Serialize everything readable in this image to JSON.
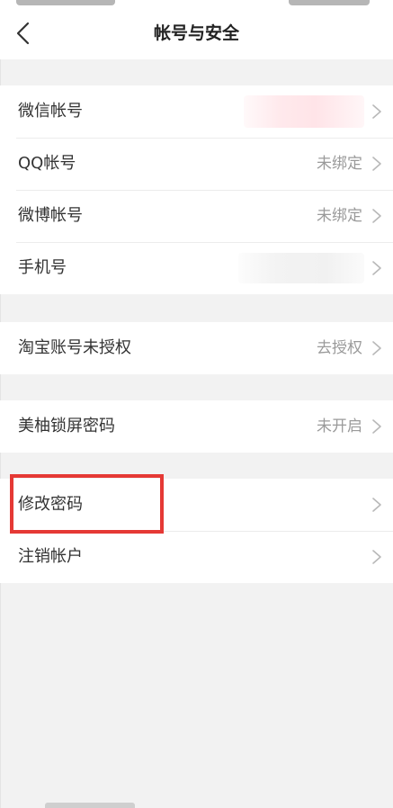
{
  "header": {
    "title": "帐号与安全",
    "back_icon": "chevron-left-icon"
  },
  "groups": [
    {
      "rows": [
        {
          "label": "微信帐号",
          "value": "",
          "redacted": true
        },
        {
          "label": "QQ帐号",
          "value": "未绑定"
        },
        {
          "label": "微博帐号",
          "value": "未绑定"
        },
        {
          "label": "手机号",
          "value": "",
          "redacted": true
        }
      ]
    },
    {
      "rows": [
        {
          "label": "淘宝账号未授权",
          "value": "去授权"
        }
      ]
    },
    {
      "rows": [
        {
          "label": "美柚锁屏密码",
          "value": "未开启"
        }
      ]
    },
    {
      "rows": [
        {
          "label": "修改密码",
          "value": "",
          "highlighted": true
        },
        {
          "label": "注销帐户",
          "value": ""
        }
      ]
    }
  ],
  "colors": {
    "highlight": "#e53935",
    "value_text": "#9a9a9a",
    "background": "#f2f2f2"
  },
  "row_chevron_icon": "chevron-right-icon"
}
